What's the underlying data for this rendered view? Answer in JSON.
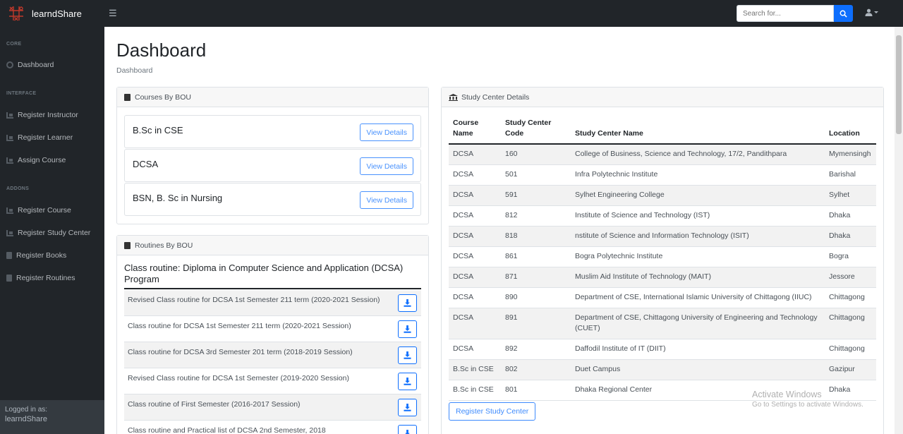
{
  "navbar": {
    "brand": "learndShare",
    "toggle_icon": "bars-icon",
    "search_placeholder": "Search for...",
    "search_icon": "search-icon",
    "user_icon": "user-icon",
    "accent": "#0d6efd"
  },
  "sidebar": {
    "headings": {
      "core": "CORE",
      "interface": "INTERFACE",
      "addons": "ADDONS"
    },
    "items": [
      {
        "label": "Dashboard",
        "icon": "tachometer-icon"
      },
      {
        "label": "Register Instructor",
        "icon": "chart-area-icon"
      },
      {
        "label": "Register Learner",
        "icon": "chart-area-icon"
      },
      {
        "label": "Assign Course",
        "icon": "chart-area-icon"
      },
      {
        "label": "Register Course",
        "icon": "chart-area-icon"
      },
      {
        "label": "Register Study Center",
        "icon": "chart-area-icon"
      },
      {
        "label": "Register Books",
        "icon": "book-icon"
      },
      {
        "label": "Register Routines",
        "icon": "book-icon"
      }
    ],
    "footer": {
      "logged_in_label": "Logged in as:",
      "username": "learndShare"
    }
  },
  "page": {
    "title": "Dashboard",
    "breadcrumb": "Dashboard"
  },
  "courses": {
    "header": "Courses By BOU",
    "button_label": "View Details",
    "items": [
      "B.Sc in CSE",
      "DCSA",
      "BSN, B. Sc in Nursing"
    ]
  },
  "routines": {
    "header": "Routines By BOU",
    "title": "Class routine: Diploma in Computer Science and Application (DCSA) Program",
    "items": [
      "Revised Class routine for DCSA 1st Semester 211 term (2020-2021 Session)",
      "Class routine for DCSA 1st Semester 211 term (2020-2021 Session)",
      "Class routine for DCSA 3rd Semester 201 term (2018-2019 Session)",
      "Revised Class routine for DCSA 1st Semester (2019-2020 Session)",
      "Class routine of First Semester (2016-2017 Session)",
      "Class routine and Practical list of DCSA 2nd Semester, 2018"
    ]
  },
  "study_centers": {
    "header": "Study Center Details",
    "columns": [
      "Course Name",
      "Study Center Code",
      "Study Center Name",
      "Location"
    ],
    "rows": [
      [
        "DCSA",
        "160",
        "College of Business, Science and Technology, 17/2, Pandithpara",
        "Mymensingh"
      ],
      [
        "DCSA",
        "501",
        "Infra Polytechnic Institute",
        "Barishal"
      ],
      [
        "DCSA",
        "591",
        "Sylhet Engineering College",
        "Sylhet"
      ],
      [
        "DCSA",
        "812",
        "Institute of Science and Technology (IST)",
        "Dhaka"
      ],
      [
        "DCSA",
        "818",
        "nstitute of Science and Information Technology (ISIT)",
        "Dhaka"
      ],
      [
        "DCSA",
        "861",
        "Bogra Polytechnic Institute",
        "Bogra"
      ],
      [
        "DCSA",
        "871",
        "Muslim Aid Institute of Technology (MAIT)",
        "Jessore"
      ],
      [
        "DCSA",
        "890",
        "Department of CSE, International Islamic University of Chittagong (IIUC)",
        "Chittagong"
      ],
      [
        "DCSA",
        "891",
        "Department of CSE, Chittagong University of Engineering and Technology (CUET)",
        "Chittagong"
      ],
      [
        "DCSA",
        "892",
        "Daffodil Institute of IT (DIIT)",
        "Chittagong"
      ],
      [
        "B.Sc in CSE",
        "802",
        "Duet Campus",
        "Gazipur"
      ],
      [
        "B.Sc in CSE",
        "801",
        "Dhaka Regional Center",
        "Dhaka"
      ]
    ],
    "register_button": "Register Study Center"
  },
  "watermark": {
    "line1": "Activate Windows",
    "line2": "Go to Settings to activate Windows."
  }
}
